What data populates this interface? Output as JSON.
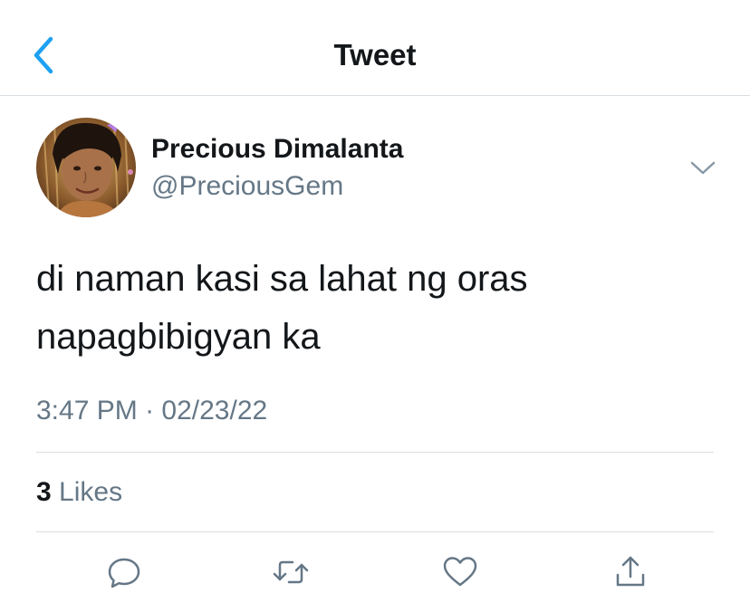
{
  "header": {
    "title": "Tweet",
    "back_icon": "chevron-left-icon"
  },
  "colors": {
    "accent": "#1da1f2",
    "text_primary": "#14171a",
    "text_secondary": "#657786",
    "divider": "#d9dee2"
  },
  "tweet": {
    "author_name": "Precious Dimalanta",
    "author_handle": "@PreciousGem",
    "text": "di naman kasi sa lahat ng oras napagbibigyan ka",
    "time": "3:47 PM",
    "separator": "·",
    "date": "02/23/22",
    "likes_count": "3",
    "likes_label": "Likes"
  },
  "actions": [
    {
      "name": "reply",
      "icon": "reply-icon"
    },
    {
      "name": "retweet",
      "icon": "retweet-icon"
    },
    {
      "name": "like",
      "icon": "heart-icon"
    },
    {
      "name": "share",
      "icon": "share-icon"
    }
  ]
}
